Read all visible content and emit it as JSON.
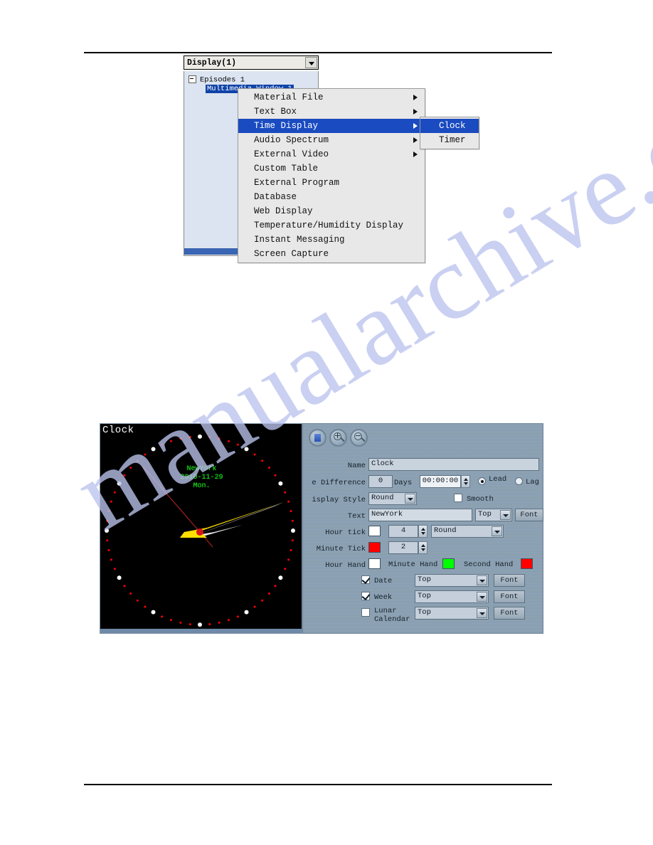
{
  "page": {
    "watermark": "manualarchive.com"
  },
  "figure_menu": {
    "combo": {
      "label": "Display(1)"
    },
    "tree": {
      "root": "Episodes 1",
      "child_selected": "Multimedia Window 1"
    },
    "context_menu": [
      {
        "label": "Material File",
        "submenu": true,
        "selected": false
      },
      {
        "label": "Text Box",
        "submenu": true,
        "selected": false
      },
      {
        "label": "Time Display",
        "submenu": true,
        "selected": true
      },
      {
        "label": "Audio Spectrum",
        "submenu": true,
        "selected": false
      },
      {
        "label": "External Video",
        "submenu": true,
        "selected": false
      },
      {
        "label": "Custom Table",
        "submenu": false,
        "selected": false
      },
      {
        "label": "External Program",
        "submenu": false,
        "selected": false
      },
      {
        "label": "Database",
        "submenu": false,
        "selected": false
      },
      {
        "label": "Web Display",
        "submenu": false,
        "selected": false
      },
      {
        "label": "Temperature/Humidity Display",
        "submenu": false,
        "selected": false
      },
      {
        "label": "Instant Messaging",
        "submenu": false,
        "selected": false
      },
      {
        "label": "Screen Capture",
        "submenu": false,
        "selected": false
      }
    ],
    "submenu": [
      {
        "label": "Clock",
        "selected": true
      },
      {
        "label": "Timer",
        "selected": false
      }
    ]
  },
  "figure_clock": {
    "preview": {
      "overlay_name": "Clock",
      "city": "NewYork",
      "date": "2010-11-29",
      "weekday": "Mon."
    },
    "toolbar": {
      "stop_icon": "stop-square-icon",
      "zoom_in_icon": "zoom-in-icon",
      "zoom_out_icon": "zoom-out-icon"
    },
    "fields": {
      "name_label": "Name",
      "name_value": "Clock",
      "time_difference_label": "e Difference",
      "days_value": "0",
      "days_unit": "Days",
      "time_value": "00:00:00",
      "lead_label": "Lead",
      "lag_label": "Lag",
      "display_style_label": "isplay Style",
      "display_style_value": "Round",
      "smooth_label": "Smooth",
      "text_label": "Text",
      "text_value": "NewYork",
      "text_position": "Top",
      "text_font_button": "Font",
      "hour_tick_label": "Hour tick",
      "hour_tick_color": "#ffffff",
      "hour_tick_size": "4",
      "hour_tick_shape": "Round",
      "minute_tick_label": "Minute Tick",
      "minute_tick_color": "#ff0000",
      "minute_tick_size": "2",
      "hour_hand_label": "Hour Hand",
      "hour_hand_color": "#ffffff",
      "minute_hand_label": "Minute Hand",
      "minute_hand_color": "#00ff00",
      "second_hand_label": "Second Hand",
      "second_hand_color": "#ff0000",
      "date_label": "Date",
      "date_checked": true,
      "date_position": "Top",
      "date_font_button": "Font",
      "week_label": "Week",
      "week_checked": true,
      "week_position": "Top",
      "week_font_button": "Font",
      "lunar_label": "Lunar Calendar",
      "lunar_checked": false,
      "lunar_position": "Top",
      "lunar_font_button": "Font"
    }
  }
}
